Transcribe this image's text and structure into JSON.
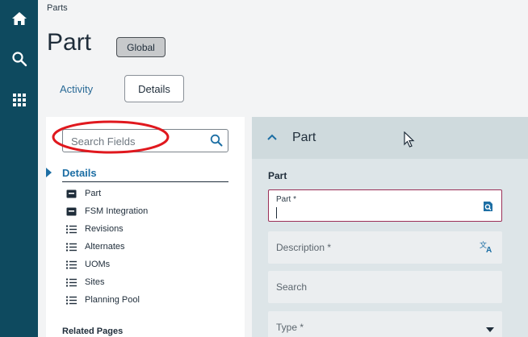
{
  "nav_rail": {
    "items": [
      {
        "icon": "home-icon"
      },
      {
        "icon": "search-icon"
      },
      {
        "icon": "apps-grid-icon"
      }
    ],
    "bg_color": "#0e4a5f"
  },
  "header": {
    "breadcrumb": "Parts",
    "title": "Part",
    "scope_badge": "Global"
  },
  "tabs": {
    "activity": "Activity",
    "details": "Details",
    "active": "Details"
  },
  "fields_panel": {
    "search_placeholder": "Search Fields",
    "details_heading": "Details",
    "items": [
      {
        "label": "Part",
        "icon": "section-icon"
      },
      {
        "label": "FSM Integration",
        "icon": "section-icon"
      },
      {
        "label": "Revisions",
        "icon": "list-icon"
      },
      {
        "label": "Alternates",
        "icon": "list-icon"
      },
      {
        "label": "UOMs",
        "icon": "list-icon"
      },
      {
        "label": "Sites",
        "icon": "list-icon"
      },
      {
        "label": "Planning Pool",
        "icon": "list-icon"
      }
    ],
    "related_heading": "Related Pages"
  },
  "form": {
    "section_title": "Part",
    "group_label": "Part",
    "fields": {
      "part_label": "Part *",
      "description_label": "Description *",
      "search_label": "Search",
      "type_label": "Type *"
    }
  },
  "colors": {
    "accent": "#1c6ea4",
    "active_field_border": "#9b2f57",
    "highlight_annotation": "#e0181e"
  }
}
